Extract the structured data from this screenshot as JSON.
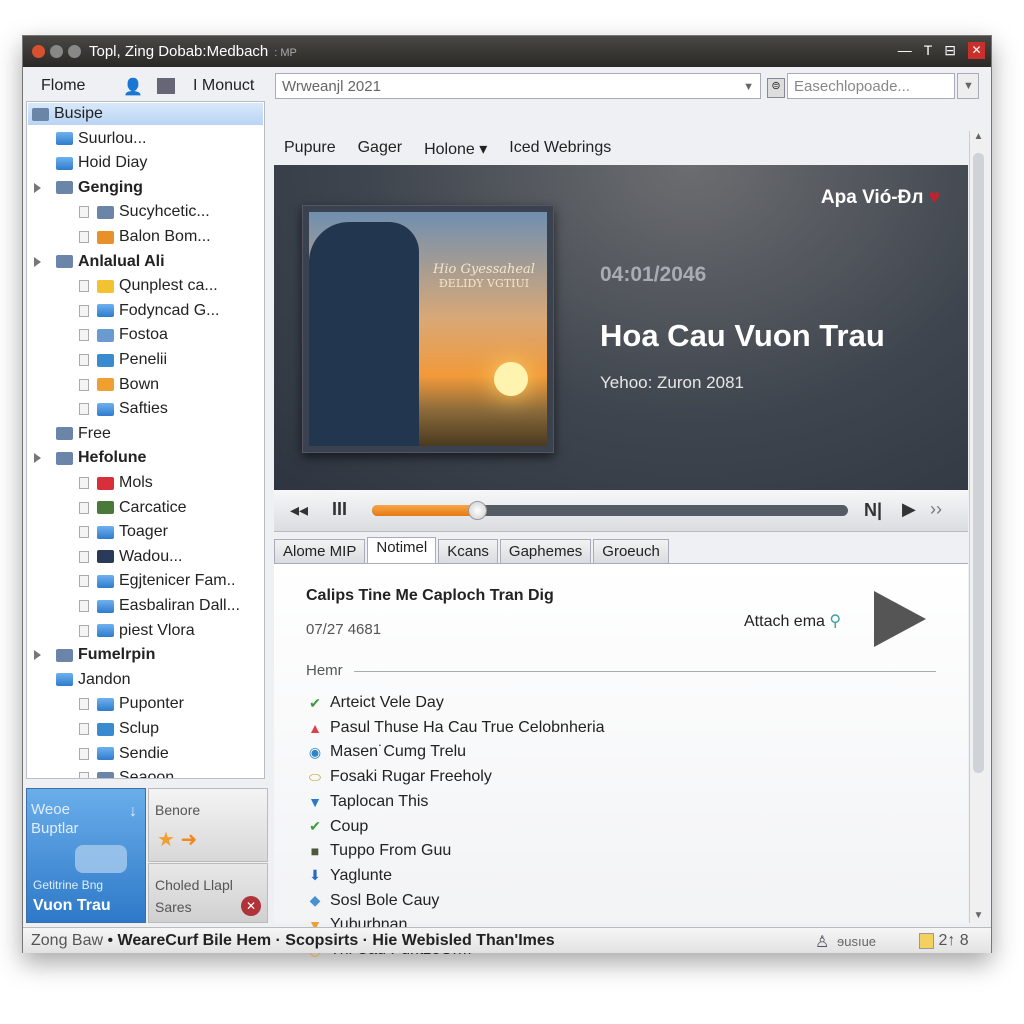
{
  "window": {
    "title": "Topl, Zing Dobab:Medbach",
    "title_suffix": ": MP",
    "minimize": "—",
    "restore": "T",
    "maximize": "⊟",
    "close": "✕"
  },
  "toolbar": {
    "home": "Flome",
    "product": "I Monuct",
    "address": "Wrweanjl 2021",
    "search_placeholder": "Easechlopoade..."
  },
  "menu": [
    "Pupure",
    "Gager",
    "Holone ▾",
    "Iced Webrings"
  ],
  "sidebar": [
    {
      "label": "Busipe",
      "level": 0,
      "selected": true,
      "icon": "library-icon"
    },
    {
      "label": "Suurlou...",
      "level": 1,
      "icon": "folder-icon"
    },
    {
      "label": "Hoid Diay",
      "level": 1,
      "icon": "folder-icon"
    },
    {
      "label": "Genging",
      "level": 1,
      "group": true,
      "icon": "gallery-icon"
    },
    {
      "label": "Sucyhcetic...",
      "level": 2,
      "icon": "image-icon"
    },
    {
      "label": "Balon Bom...",
      "level": 2,
      "icon": "box-icon"
    },
    {
      "label": "Anlalual Ali",
      "level": 1,
      "group": true,
      "icon": "chart-icon"
    },
    {
      "label": "Qunplest ca...",
      "level": 2,
      "icon": "star-icon"
    },
    {
      "label": "Fodyncad G...",
      "level": 2,
      "icon": "folder-icon"
    },
    {
      "label": "Fostoa",
      "level": 2,
      "icon": "sync-icon"
    },
    {
      "label": "Penelii",
      "level": 2,
      "icon": "arrow-up-icon"
    },
    {
      "label": "Bown",
      "level": 2,
      "icon": "ring-icon"
    },
    {
      "label": "Safties",
      "level": 2,
      "icon": "folder-icon"
    },
    {
      "label": "Free",
      "level": 1,
      "icon": "tools-icon"
    },
    {
      "label": "Hefolune",
      "level": 1,
      "group": true,
      "icon": "grid-icon"
    },
    {
      "label": "Mols",
      "level": 2,
      "icon": "heart-icon"
    },
    {
      "label": "Carcatice",
      "level": 2,
      "icon": "plant-icon"
    },
    {
      "label": "Toager",
      "level": 2,
      "icon": "folder-icon"
    },
    {
      "label": "Wadou...",
      "level": 2,
      "icon": "photo-icon"
    },
    {
      "label": "Egjtenicer Fam..",
      "level": 2,
      "icon": "folder-icon"
    },
    {
      "label": "Easbaliran Dall...",
      "level": 2,
      "icon": "folder-icon"
    },
    {
      "label": "piest Vlora",
      "level": 2,
      "icon": "folder-icon"
    },
    {
      "label": "Fumelrpin",
      "level": 1,
      "group": true,
      "icon": "picture-folder-icon"
    },
    {
      "label": "Jandon",
      "level": 1,
      "icon": "folder-icon"
    },
    {
      "label": "Puponter",
      "level": 2,
      "icon": "folder-icon"
    },
    {
      "label": "Sclup",
      "level": 2,
      "icon": "globe-icon"
    },
    {
      "label": "Sendie",
      "level": 2,
      "icon": "folder-icon"
    },
    {
      "label": "Seaoon",
      "level": 2,
      "icon": "film-icon"
    }
  ],
  "tiles": {
    "t1_line1": "Weoe",
    "t1_line2": "Buptlar",
    "t1_sub": "Getitrine Bng",
    "t1_title": "Vuon Trau",
    "t2": "Benore",
    "t3_line1": "Choled Llapl",
    "t3_line2": "Sares"
  },
  "hero": {
    "badge": "Apa Vió-Ðл",
    "date": "04:01/2046",
    "song_title": "Hoa Cau Vuon Trau",
    "artist": "Yehoo: Zuron 2081",
    "art_text1": "Hio Gyessaheal",
    "art_text2": "ÐELIDY VGTIUI"
  },
  "player": {
    "progress_percent": 22
  },
  "tabs": [
    {
      "label": "Alome MIP"
    },
    {
      "label": "Notimel",
      "active": true
    },
    {
      "label": "Kcans"
    },
    {
      "label": "Gaphemes"
    },
    {
      "label": "Groeuch"
    }
  ],
  "detail": {
    "title": "Calips Tine Me Caploch Tran Dig",
    "code": "07/27 4681",
    "attach": "Attach ema",
    "section": "Hemr",
    "items": [
      {
        "label": "Arteict Vele Day",
        "icon": "check-icon",
        "glyph": "✔",
        "color": "#3c9a3c"
      },
      {
        "label": "Pasul Thuse Ha Cau True Celobnheria",
        "icon": "warning-icon",
        "glyph": "▲",
        "color": "#d9434e"
      },
      {
        "label": "Masen˙Cumg Trelu",
        "icon": "circle-icon",
        "glyph": "◉",
        "color": "#2a87c8"
      },
      {
        "label": "Fosaki Rugar Freeholy",
        "icon": "disc-icon",
        "glyph": "⬭",
        "color": "#c89a18"
      },
      {
        "label": "Taplocan This",
        "icon": "triangle-down-icon",
        "glyph": "▼",
        "color": "#2a7ac8"
      },
      {
        "label": "Coup",
        "icon": "check-icon",
        "glyph": "✔",
        "color": "#3c9a3c"
      },
      {
        "label": "Tuppo From Guu",
        "icon": "bag-icon",
        "glyph": "■",
        "color": "#4a5a3a"
      },
      {
        "label": "Yaglunte",
        "icon": "arrow-down-icon",
        "glyph": "⬇",
        "color": "#2a6ac0"
      },
      {
        "label": "Sosl Bole Cauy",
        "icon": "diamond-icon",
        "glyph": "◆",
        "color": "#4a90d0"
      },
      {
        "label": "Yuburbnan",
        "icon": "funnel-icon",
        "glyph": "▼",
        "color": "#f0a030"
      },
      {
        "label": "Thi Cau PuntzeOrm",
        "icon": "bowl-icon",
        "glyph": "◡",
        "color": "#d8a030"
      }
    ]
  },
  "status": {
    "left": "Zong Baw",
    "main": "WeareCurf Bile Hem · Scopsirts · Hie Webisled Than'Imes",
    "right1": "ɘusıue",
    "right2": "2↑ 8"
  },
  "colors": {
    "accent": "#e47a12",
    "selection": "#c4dbf5",
    "titlebar": "#2b2926"
  }
}
